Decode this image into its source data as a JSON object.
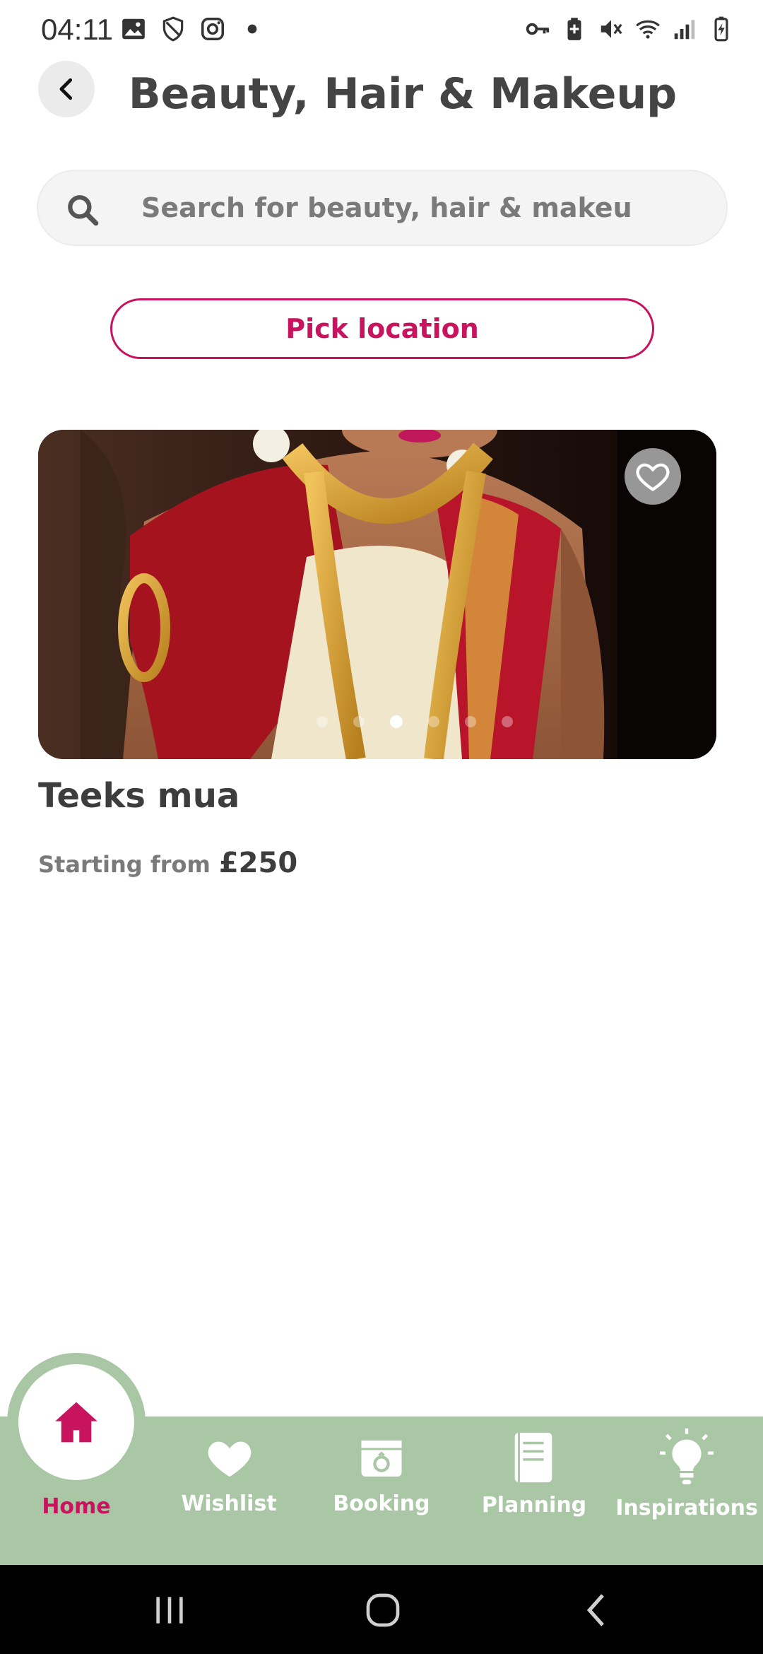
{
  "status_bar": {
    "time": "04:11",
    "left_icons": [
      "gallery-icon",
      "shield-icon",
      "instagram-icon",
      "dot-icon"
    ],
    "right_icons": [
      "key-icon",
      "battery-saver-icon",
      "mute-icon",
      "wifi-icon",
      "signal-icon",
      "battery-icon"
    ]
  },
  "header": {
    "title": "Beauty, Hair & Makeup",
    "back_icon": "chevron-left-icon"
  },
  "search": {
    "placeholder": "Search for beauty, hair & makeu",
    "icon": "search-icon"
  },
  "location": {
    "button_label": "Pick location"
  },
  "vendor": {
    "name": "Teeks mua",
    "price_prefix": "Starting from",
    "price": "£250",
    "image_description_icon": "bridal-photo",
    "carousel": {
      "count": 6,
      "active_index": 2
    },
    "wishlist_icon": "heart-outline-icon"
  },
  "bottom_nav": {
    "items": [
      {
        "label": "Home",
        "icon": "home-icon",
        "active": true
      },
      {
        "label": "Wishlist",
        "icon": "heart-icon",
        "active": false
      },
      {
        "label": "Booking",
        "icon": "calendar-ring-icon",
        "active": false
      },
      {
        "label": "Planning",
        "icon": "notebook-icon",
        "active": false
      },
      {
        "label": "Inspirations",
        "icon": "lightbulb-icon",
        "active": false
      }
    ]
  },
  "colors": {
    "accent": "#c8135f",
    "nav_background": "#a9c7a4",
    "search_background": "#f4f4f4"
  },
  "system_nav": {
    "buttons": [
      "recents-icon",
      "home-circle-icon",
      "back-icon"
    ]
  }
}
